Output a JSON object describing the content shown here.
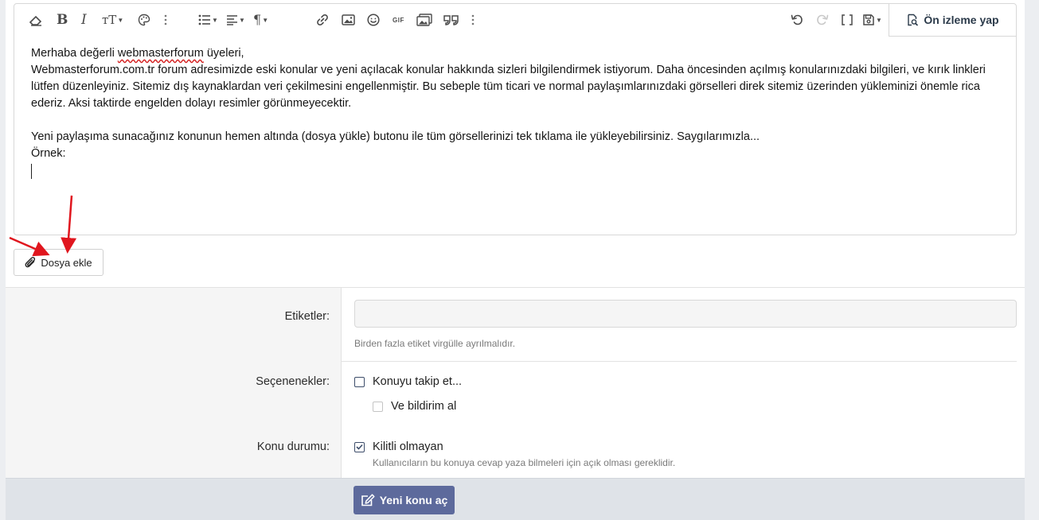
{
  "toolbar": {
    "preview_label": "Ön izleme yap",
    "icons": [
      "eraser-icon",
      "bold-icon",
      "italic-icon",
      "text-size-icon",
      "palette-icon",
      "more-icon",
      "list-icon",
      "align-icon",
      "paragraph-icon",
      "link-icon",
      "image-icon",
      "smiley-icon",
      "gif-icon",
      "media-icon",
      "quote-icon",
      "more-icon",
      "undo-icon",
      "redo-icon",
      "bbcode-icon",
      "save-draft-icon"
    ],
    "gif_label": "GIF"
  },
  "editor": {
    "greeting_before": "Merhaba değerli ",
    "greeting_word": "webmasterforum",
    "greeting_after": " üyeleri,",
    "line2": "Webmasterforum.com.tr forum adresimizde eski konular ve yeni açılacak konular hakkında sizleri bilgilendirmek istiyorum. Daha öncesinden açılmış konularınızdaki bilgileri, ve kırık linkleri lütfen düzenleyiniz. Sitemiz dış kaynaklardan veri çekilmesini engellenmiştir. Bu sebeple tüm ticari ve normal paylaşımlarınızdaki görselleri direk sitemiz üzerinden yükleminizi önemle rica ederiz. Aksi taktirde engelden dolayı resimler görünmeyecektir.",
    "line3": "Yeni paylaşıma sunacağınız konunun hemen altında (dosya yükle) butonu ile tüm görsellerinizi tek tıklama ile yükleyebilirsiniz. Saygılarımızla...",
    "line4": "Örnek:"
  },
  "attach": {
    "label": "Dosya ekle"
  },
  "tags": {
    "label": "Etiketler:",
    "placeholder": "",
    "hint": "Birden fazla etiket virgülle ayrılmalıdır."
  },
  "options": {
    "label": "Seçenenekler:",
    "watch": {
      "label": "Konuyu takip et...",
      "checked": false
    },
    "notify": {
      "label": "Ve bildirim al",
      "checked": false
    }
  },
  "status": {
    "label": "Konu durumu:",
    "unlocked": {
      "label": "Kilitli olmayan",
      "checked": true
    },
    "hint": "Kullanıcıların bu konuya cevap yaza bilmeleri için açık olması gereklidir."
  },
  "submit": {
    "label": "Yeni konu aç"
  },
  "colors": {
    "accent": "#5d6a9c",
    "annotation": "#e0161e",
    "footer": "#dfe3e8"
  }
}
